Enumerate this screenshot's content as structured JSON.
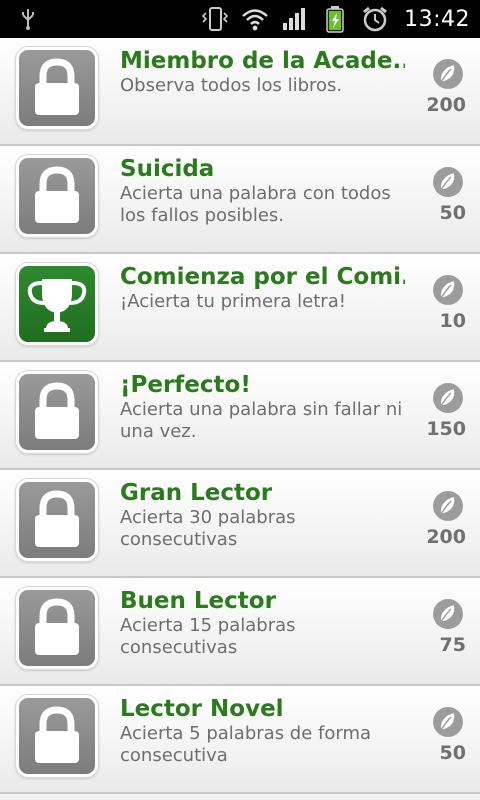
{
  "status_bar": {
    "time": "13:42",
    "icons": [
      "usb-icon",
      "vibrate-icon",
      "wifi-icon",
      "signal-icon",
      "battery-charging-icon",
      "alarm-icon"
    ]
  },
  "achievements": [
    {
      "title": "Miembro de la Acade...",
      "description": "Observa todos los libros.",
      "points": "200",
      "status": "locked"
    },
    {
      "title": "Suicida",
      "description": "Acierta una palabra con todos los fallos posibles.",
      "points": "50",
      "status": "locked"
    },
    {
      "title": "Comienza por el Comi...",
      "description": "¡Acierta tu primera letra!",
      "points": "10",
      "status": "unlocked"
    },
    {
      "title": "¡Perfecto!",
      "description": "Acierta una palabra sin fallar ni una vez.",
      "points": "150",
      "status": "locked"
    },
    {
      "title": "Gran Lector",
      "description": "Acierta 30 palabras consecutivas",
      "points": "200",
      "status": "locked"
    },
    {
      "title": "Buen Lector",
      "description": "Acierta 15 palabras consecutivas",
      "points": "75",
      "status": "locked"
    },
    {
      "title": "Lector Novel",
      "description": "Acierta 5 palabras de forma consecutiva",
      "points": "50",
      "status": "locked"
    }
  ],
  "colors": {
    "title_green": "#2b7a1e",
    "locked_badge": "#8a8a8a",
    "unlocked_badge": "#2a7f2a"
  }
}
